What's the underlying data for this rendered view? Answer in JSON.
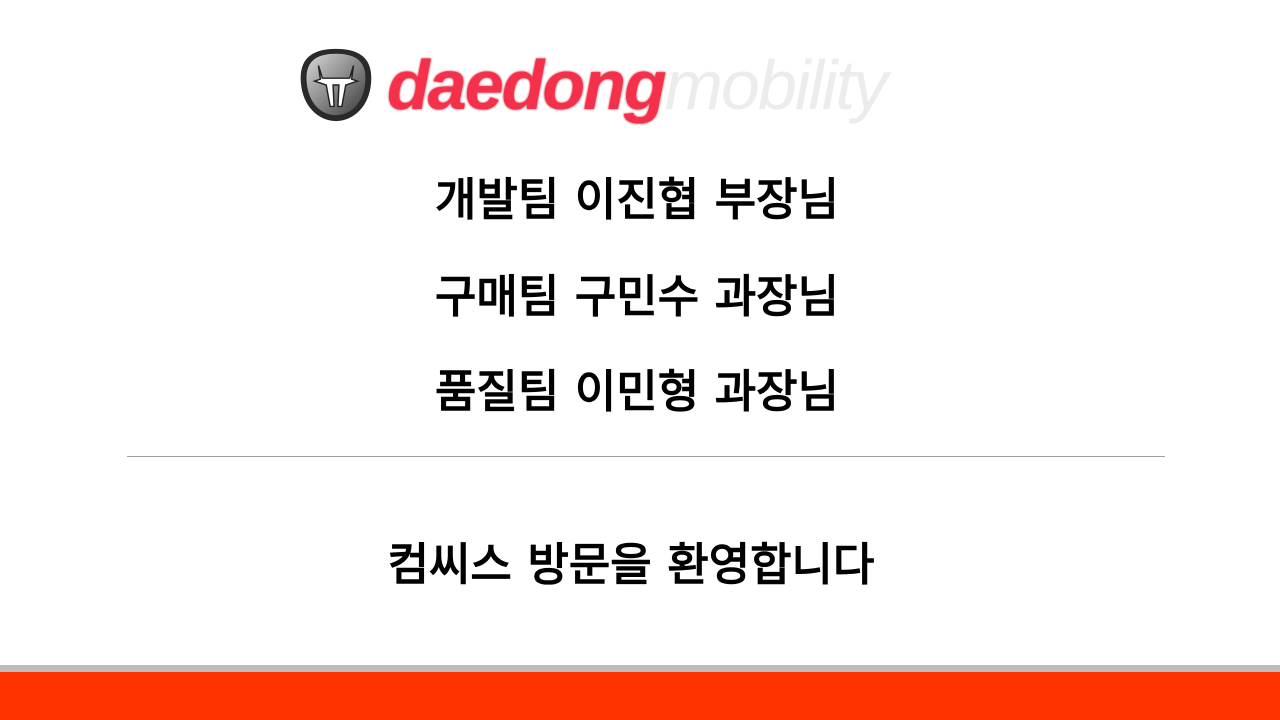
{
  "logo": {
    "brand_primary": "daedong",
    "brand_secondary": "mobility"
  },
  "guests": [
    "개발팀 이진협 부장님",
    "구매팀 구민수 과장님",
    "품질팀 이민형 과장님"
  ],
  "welcome": "컴씨스 방문을 환영합니다",
  "colors": {
    "accent": "#ff3300",
    "brand_red": "#f5304a",
    "band_grey": "#bcbcbc"
  }
}
